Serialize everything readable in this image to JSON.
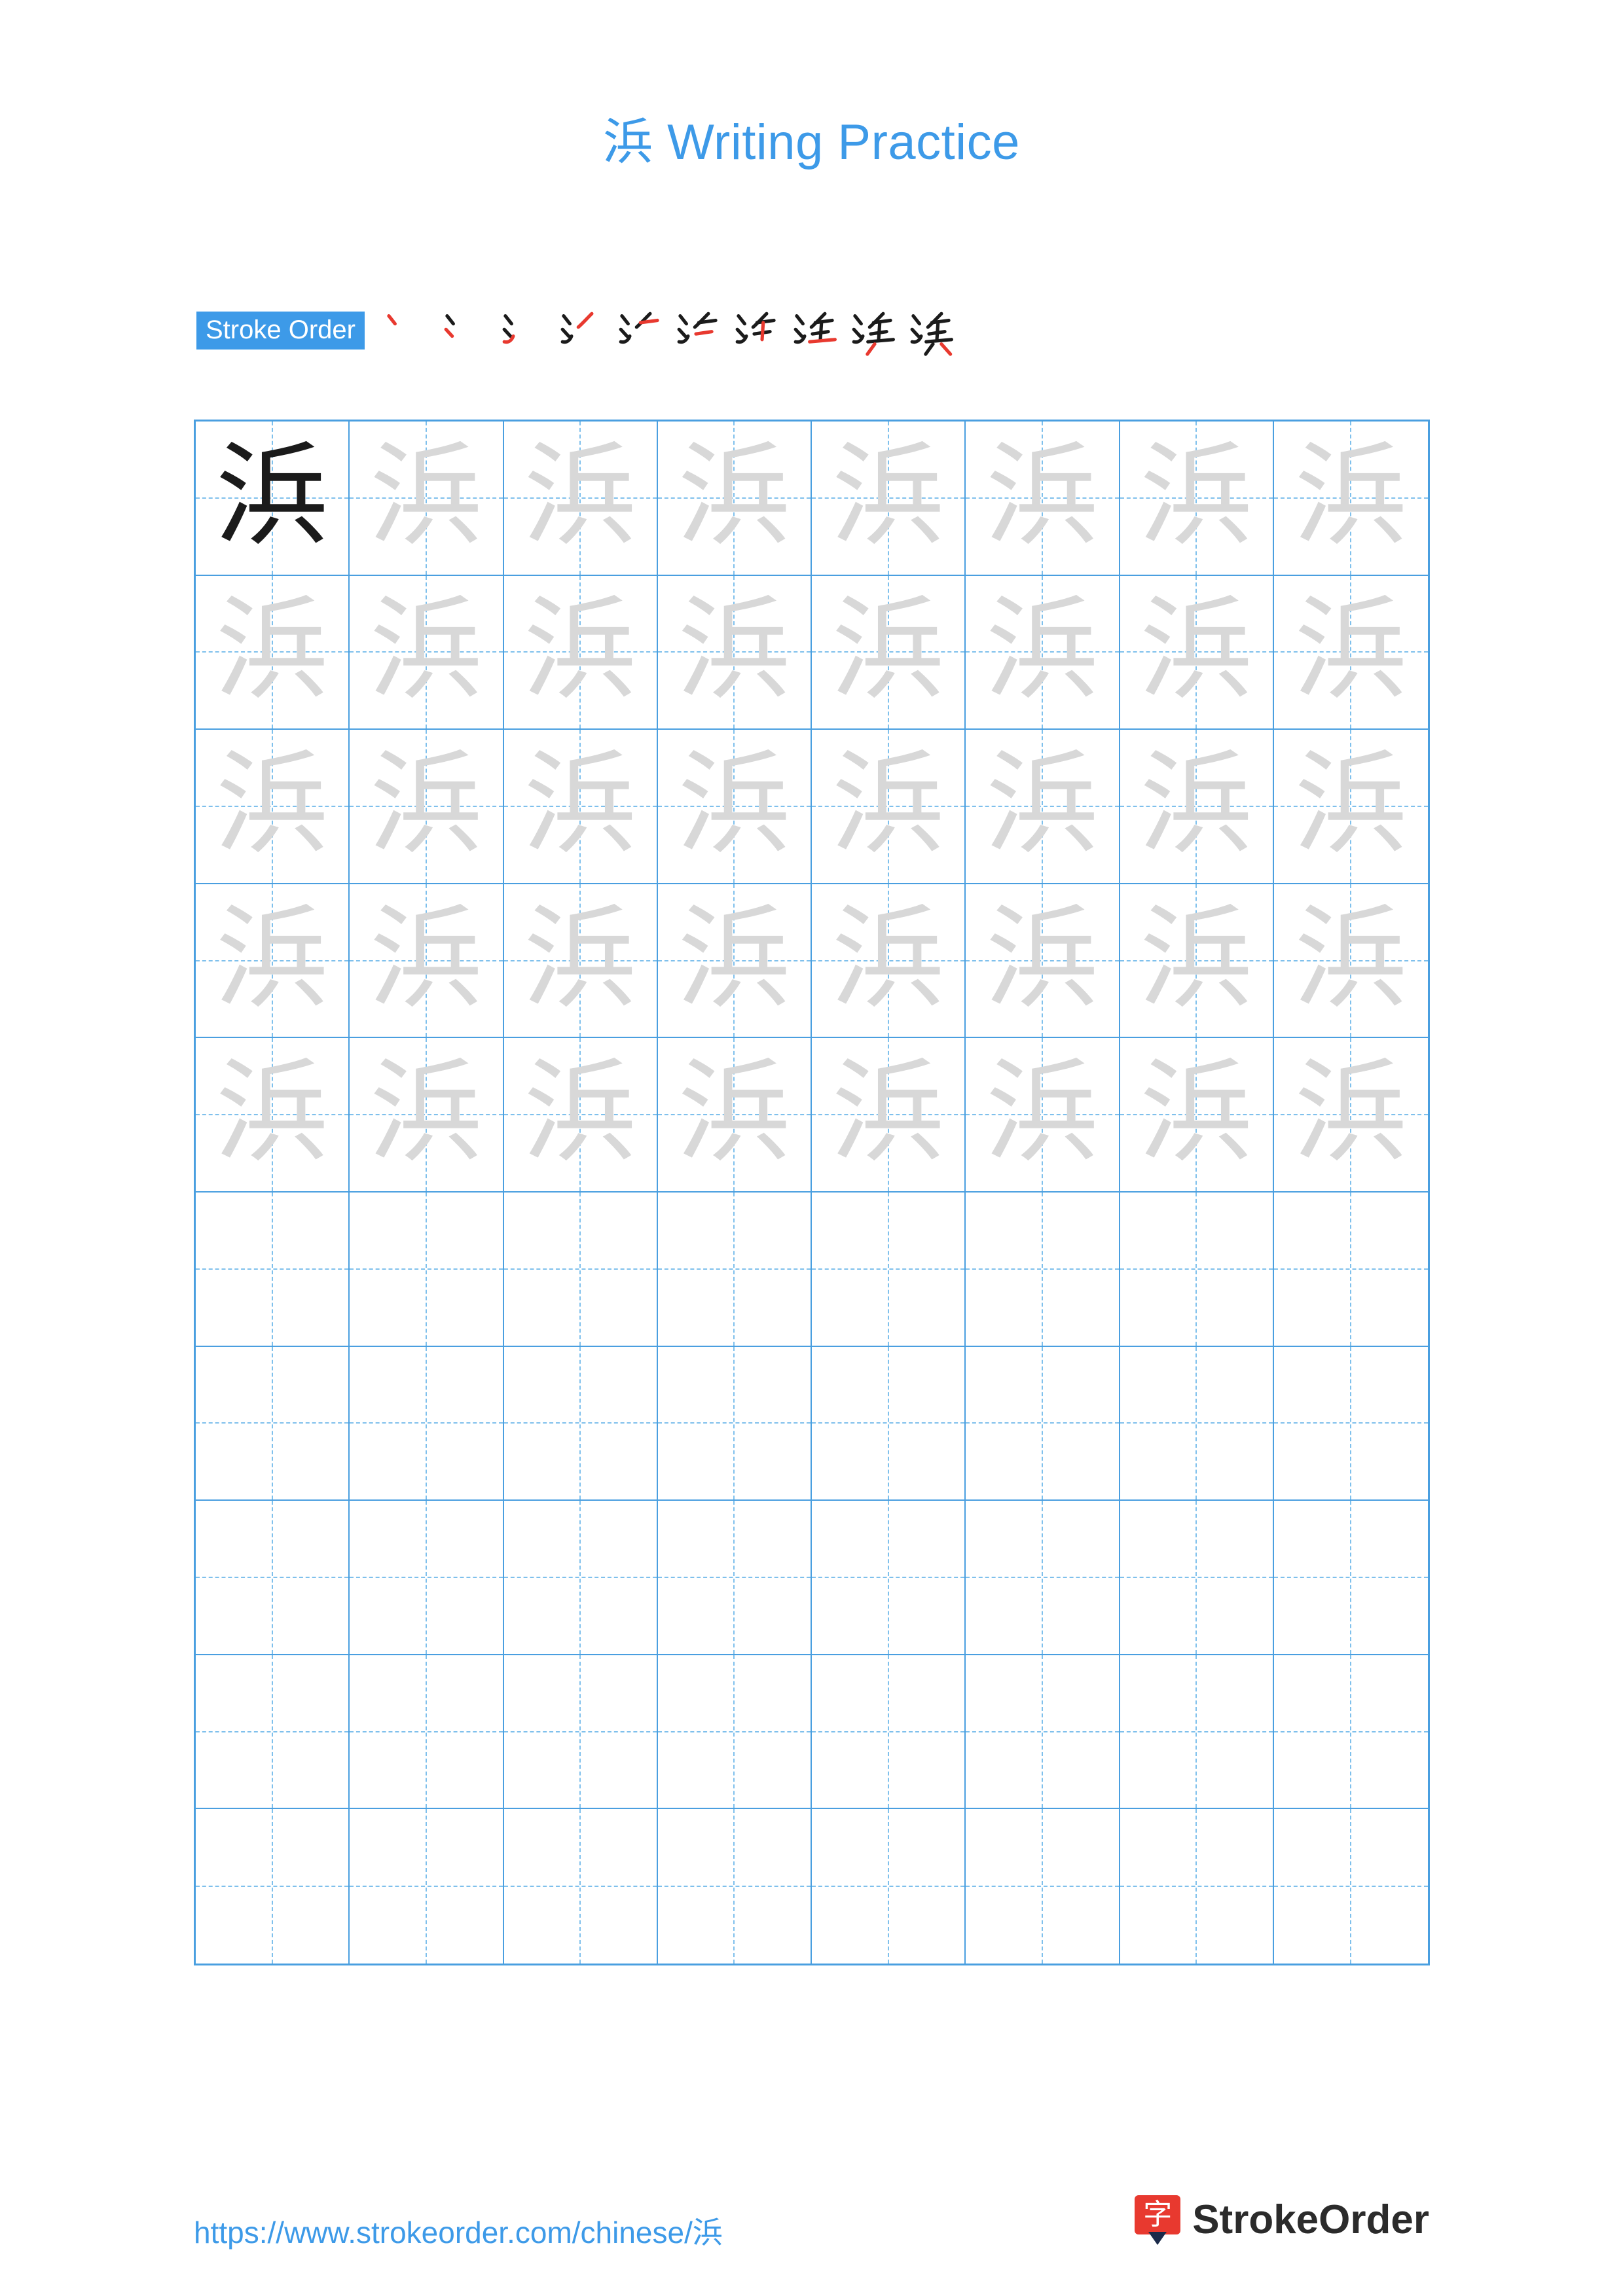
{
  "document": {
    "title": "浜 Writing Practice",
    "character": "浜",
    "title_color": "#3d9ae8"
  },
  "stroke_order": {
    "label": "Stroke Order",
    "label_bg": "#3d9ae8",
    "highlight_color": "#e8392f",
    "ink_color": "#1b1b1b",
    "steps": [
      {
        "index": 1,
        "partial": "丶"
      },
      {
        "index": 2,
        "partial": "丶"
      },
      {
        "index": 3,
        "partial": "氵"
      },
      {
        "index": 4,
        "partial": "氵丿"
      },
      {
        "index": 5,
        "partial": "氵丿一"
      },
      {
        "index": 6,
        "partial": "氵斤"
      },
      {
        "index": 7,
        "partial": "浜"
      },
      {
        "index": 8,
        "partial": "浜"
      },
      {
        "index": 9,
        "partial": "浜"
      },
      {
        "index": 10,
        "partial": "浜"
      }
    ]
  },
  "practice_grid": {
    "columns": 8,
    "rows": 10,
    "grid_line_color": "#4a9fe0",
    "guide_line_color": "#7fc0ec",
    "dark_glyph_color": "#1b1b1b",
    "trace_glyph_color": "#d8d8d8",
    "cells": [
      [
        "dark",
        "trace",
        "trace",
        "trace",
        "trace",
        "trace",
        "trace",
        "trace"
      ],
      [
        "trace",
        "trace",
        "trace",
        "trace",
        "trace",
        "trace",
        "trace",
        "trace"
      ],
      [
        "trace",
        "trace",
        "trace",
        "trace",
        "trace",
        "trace",
        "trace",
        "trace"
      ],
      [
        "trace",
        "trace",
        "trace",
        "trace",
        "trace",
        "trace",
        "trace",
        "trace"
      ],
      [
        "trace",
        "trace",
        "trace",
        "trace",
        "trace",
        "trace",
        "trace",
        "trace"
      ],
      [
        "empty",
        "empty",
        "empty",
        "empty",
        "empty",
        "empty",
        "empty",
        "empty"
      ],
      [
        "empty",
        "empty",
        "empty",
        "empty",
        "empty",
        "empty",
        "empty",
        "empty"
      ],
      [
        "empty",
        "empty",
        "empty",
        "empty",
        "empty",
        "empty",
        "empty",
        "empty"
      ],
      [
        "empty",
        "empty",
        "empty",
        "empty",
        "empty",
        "empty",
        "empty",
        "empty"
      ],
      [
        "empty",
        "empty",
        "empty",
        "empty",
        "empty",
        "empty",
        "empty",
        "empty"
      ]
    ]
  },
  "footer": {
    "url": "https://www.strokeorder.com/chinese/浜",
    "brand_name": "StrokeOrder",
    "brand_logo_char": "字",
    "brand_logo_color": "#e8392f"
  }
}
